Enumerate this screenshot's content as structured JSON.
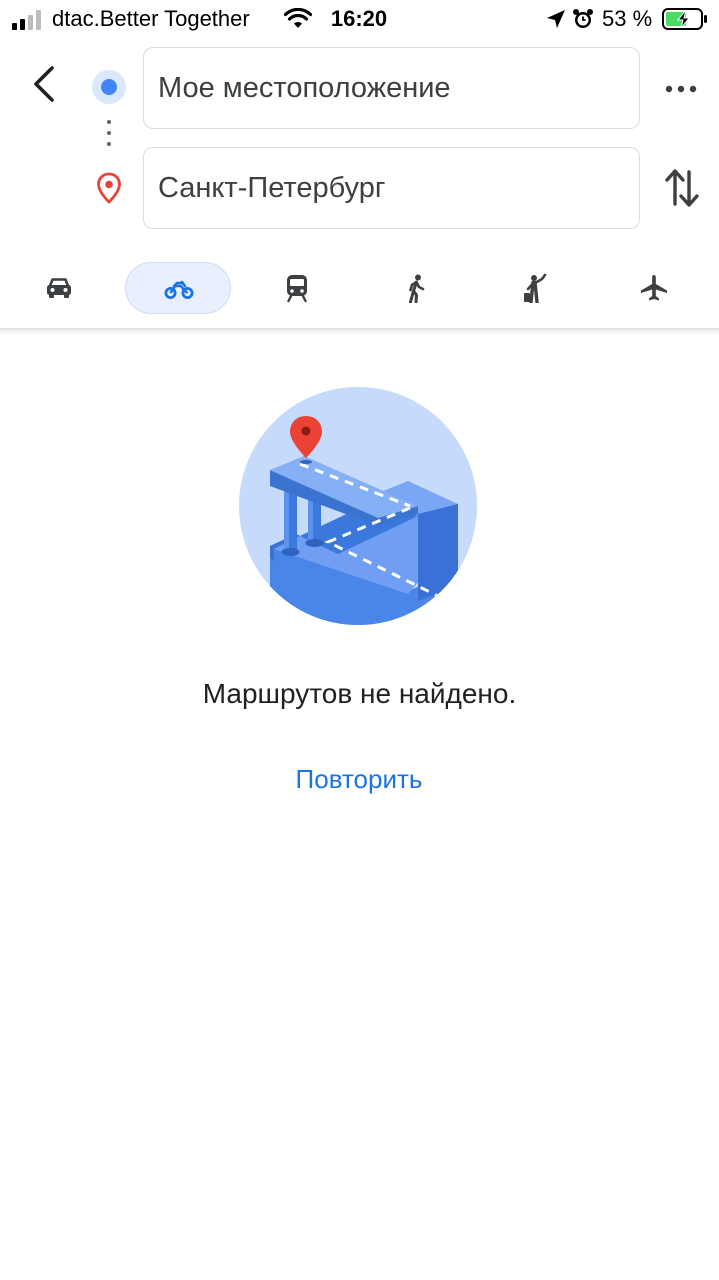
{
  "status_bar": {
    "carrier": "dtac.Better Together",
    "time": "16:20",
    "battery_percent": "53 %"
  },
  "directions": {
    "origin_value": "Мое местоположение",
    "destination_value": "Санкт-Петербург"
  },
  "travel_modes": [
    {
      "icon": "car-icon",
      "selected": false
    },
    {
      "icon": "motorcycle-icon",
      "selected": true
    },
    {
      "icon": "train-icon",
      "selected": false
    },
    {
      "icon": "walk-icon",
      "selected": false
    },
    {
      "icon": "ride-hail-icon",
      "selected": false
    },
    {
      "icon": "flight-icon",
      "selected": false
    }
  ],
  "empty_state": {
    "illustration": "no-route-illustration",
    "message": "Маршрутов не найдено.",
    "retry_label": "Повторить"
  },
  "colors": {
    "accent_blue": "#1a73e8",
    "origin_dot": "#4285f4",
    "destination_pin": "#ea4335",
    "selected_mode_bg": "#e8f0fe"
  }
}
